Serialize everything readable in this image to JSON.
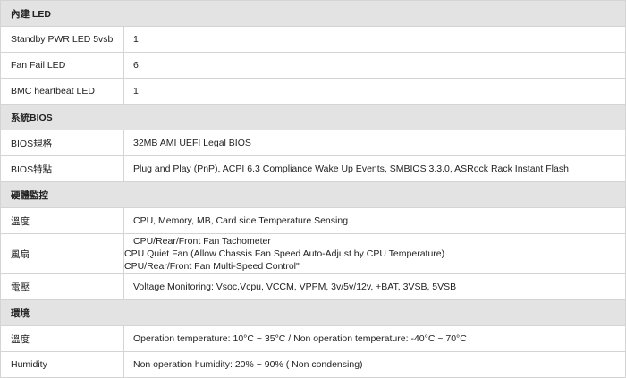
{
  "sections": [
    {
      "title": "內建 LED",
      "rows": [
        {
          "label": "Standby PWR LED 5vsb",
          "value": "1"
        },
        {
          "label": "Fan Fail LED",
          "value": "6"
        },
        {
          "label": "BMC heartbeat LED",
          "value": "1"
        }
      ]
    },
    {
      "title": "系統BIOS",
      "rows": [
        {
          "label": "BIOS規格",
          "value": "32MB AMI UEFI Legal BIOS"
        },
        {
          "label": "BIOS特點",
          "value": "Plug and Play (PnP), ACPI 6.3 Compliance Wake Up Events, SMBIOS 3.3.0, ASRock Rack Instant Flash"
        }
      ]
    },
    {
      "title": "硬體監控",
      "rows": [
        {
          "label": "溫度",
          "value": "CPU, Memory, MB, Card side Temperature Sensing"
        },
        {
          "label": "風扇",
          "lines": [
            "CPU/Rear/Front Fan Tachometer",
            "CPU Quiet Fan (Allow Chassis Fan Speed Auto-Adjust by CPU Temperature)",
            "CPU/Rear/Front Fan Multi-Speed Control\""
          ]
        },
        {
          "label": "電壓",
          "value": "Voltage Monitoring: Vsoc,Vcpu, VCCM, VPPM, 3v/5v/12v, +BAT, 3VSB, 5VSB"
        }
      ]
    },
    {
      "title": "環境",
      "rows": [
        {
          "label": "溫度",
          "value": "Operation temperature: 10°C ~ 35°C / Non operation temperature: -40°C ~ 70°C"
        },
        {
          "label": "Humidity",
          "value": "Non operation humidity: 20% ~ 90% ( Non condensing)"
        }
      ]
    }
  ]
}
